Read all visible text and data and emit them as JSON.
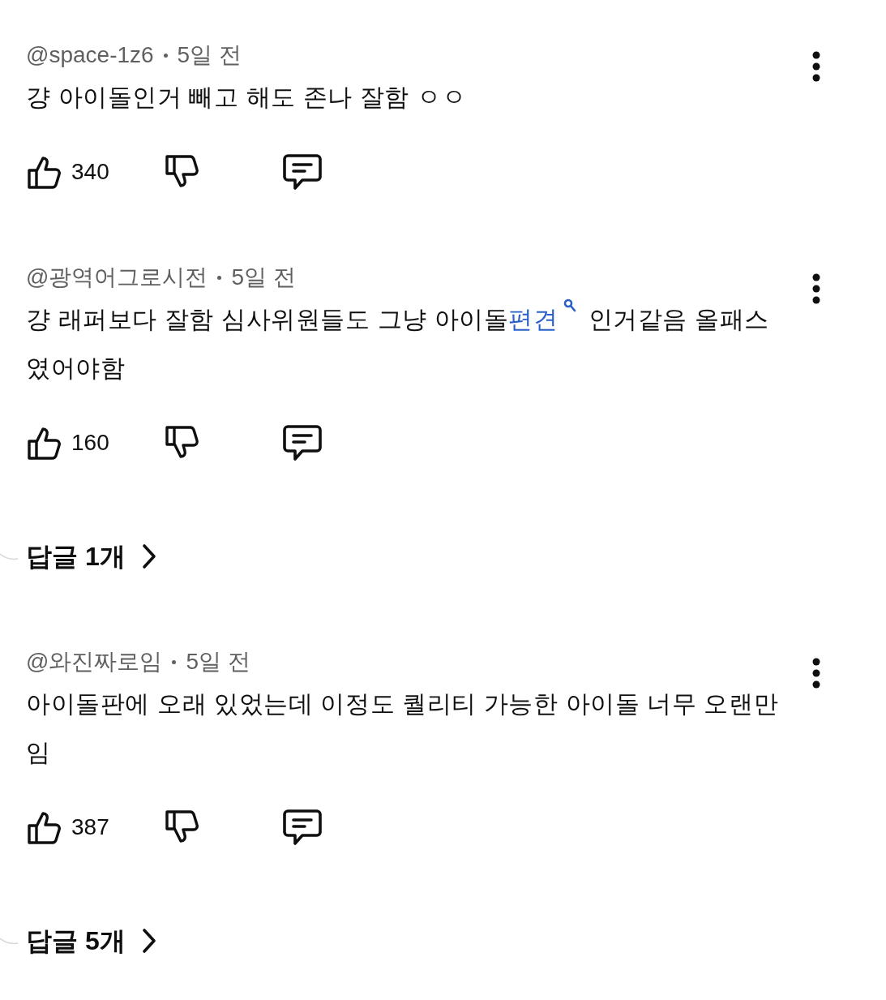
{
  "comments": [
    {
      "author": "@space-1z6",
      "time": "5일 전",
      "body": [
        {
          "kind": "plain",
          "text": "걍 아이돌인거 빼고 해도 존나 잘함 ㅇㅇ"
        }
      ],
      "likes": "340"
    },
    {
      "author": "@광역어그로시전",
      "time": "5일 전",
      "body": [
        {
          "kind": "plain",
          "text": "걍 래퍼보다 잘함 심사위원들도 그냥 아이돌"
        },
        {
          "kind": "search_link",
          "text": "편견"
        },
        {
          "kind": "plain",
          "text": " 인거같음 올패스였어야함"
        }
      ],
      "likes": "160",
      "replies": "답글 1개"
    },
    {
      "author": "@와진짜로임",
      "time": "5일 전",
      "body": [
        {
          "kind": "plain",
          "text": "아이돌판에 오래 있었는데 이정도 퀄리티 가능한 아이돌 너무 오랜만임"
        }
      ],
      "likes": "387",
      "replies": "답글 5개"
    }
  ]
}
